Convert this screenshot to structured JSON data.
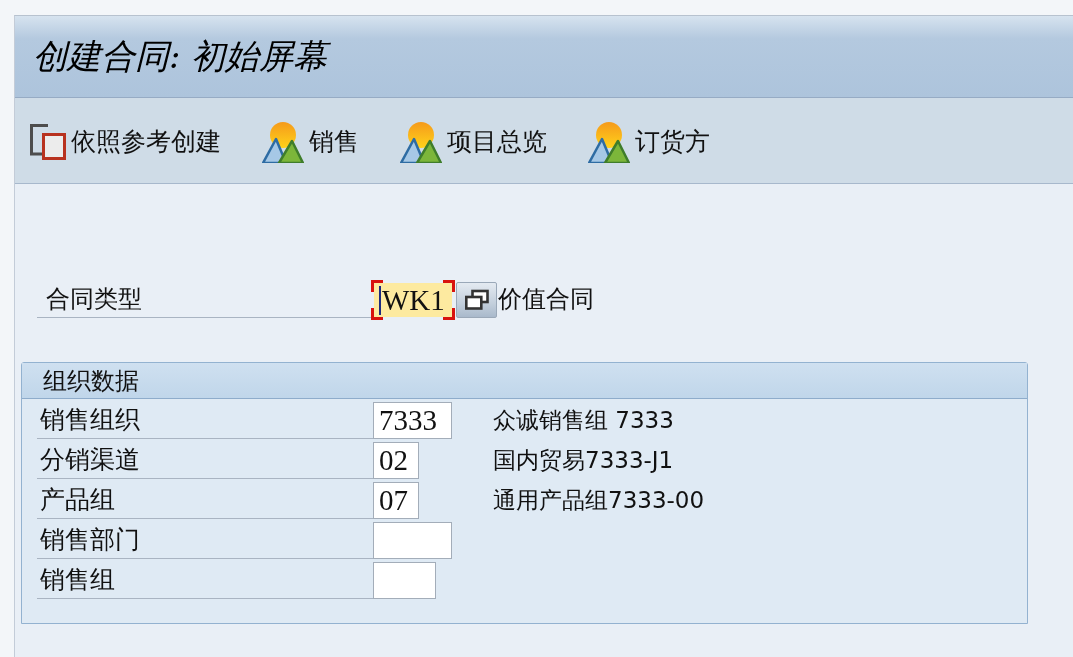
{
  "window": {
    "title": "创建合同: 初始屏幕"
  },
  "toolbar": [
    {
      "kind": "copy",
      "label": "依照参考创建"
    },
    {
      "kind": "mountain",
      "label": "销售"
    },
    {
      "kind": "mountain",
      "label": "项目总览"
    },
    {
      "kind": "mountain",
      "label": "订货方"
    }
  ],
  "contract_type": {
    "label": "合同类型",
    "value": "WK1",
    "focused": true,
    "description": "价值合同"
  },
  "org_data": {
    "title": "组织数据",
    "fields": [
      {
        "label": "销售组织",
        "value": "7333",
        "description": "众诚销售组 7333"
      },
      {
        "label": "分销渠道",
        "value": "02",
        "description": "国内贸易7333-J1"
      },
      {
        "label": "产品组",
        "value": "07",
        "description": "通用产品组7333-00"
      },
      {
        "label": "销售部门"
      },
      {
        "label": "销售组"
      }
    ]
  }
}
